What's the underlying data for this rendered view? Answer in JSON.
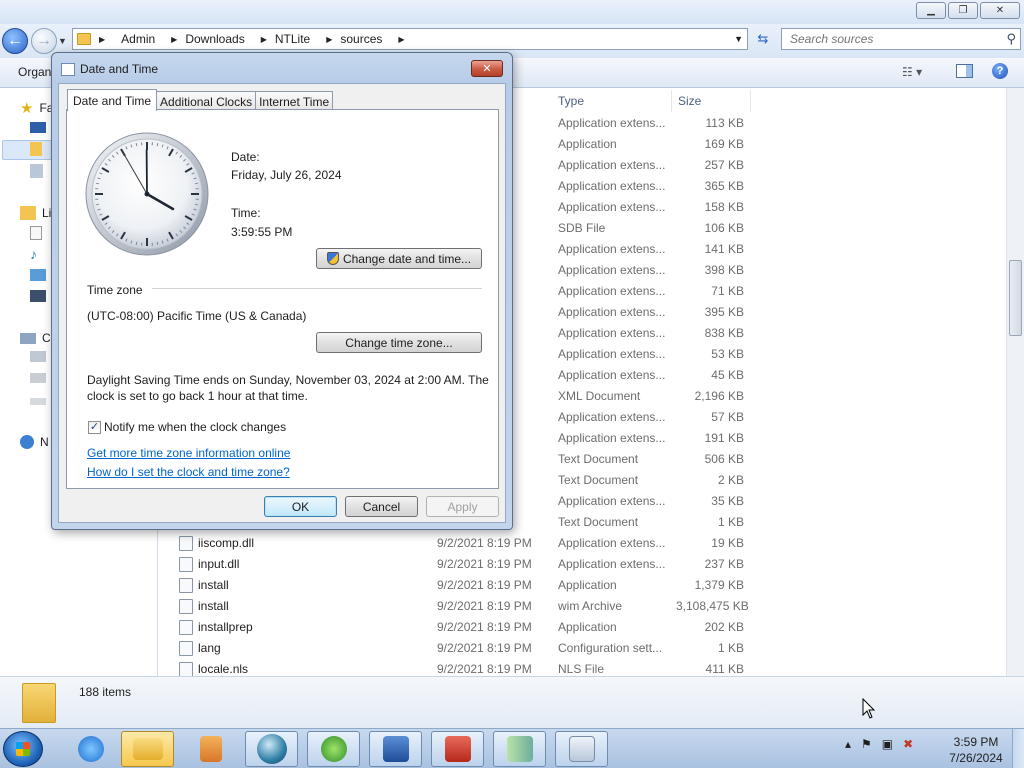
{
  "explorer": {
    "breadcrumb": [
      "Admin",
      "Downloads",
      "NTLite",
      "sources"
    ],
    "search_placeholder": "Search sources",
    "cmd_organize": "Organ",
    "columns": {
      "type": "Type",
      "size": "Size"
    },
    "nav_labels": [
      "Fa",
      "Li",
      "C",
      "N"
    ],
    "files": [
      {
        "name": "",
        "date": "PM",
        "type": "Application extens...",
        "size": "113 KB"
      },
      {
        "name": "",
        "date": "PM",
        "type": "Application",
        "size": "169 KB"
      },
      {
        "name": "",
        "date": "PM",
        "type": "Application extens...",
        "size": "257 KB"
      },
      {
        "name": "",
        "date": "PM",
        "type": "Application extens...",
        "size": "365 KB"
      },
      {
        "name": "",
        "date": "PM",
        "type": "Application extens...",
        "size": "158 KB"
      },
      {
        "name": "",
        "date": "PM",
        "type": "SDB File",
        "size": "106 KB"
      },
      {
        "name": "",
        "date": "PM",
        "type": "Application extens...",
        "size": "141 KB"
      },
      {
        "name": "",
        "date": "PM",
        "type": "Application extens...",
        "size": "398 KB"
      },
      {
        "name": "",
        "date": "PM",
        "type": "Application extens...",
        "size": "71 KB"
      },
      {
        "name": "",
        "date": "PM",
        "type": "Application extens...",
        "size": "395 KB"
      },
      {
        "name": "",
        "date": "PM",
        "type": "Application extens...",
        "size": "838 KB"
      },
      {
        "name": "",
        "date": "PM",
        "type": "Application extens...",
        "size": "53 KB"
      },
      {
        "name": "",
        "date": "PM",
        "type": "Application extens...",
        "size": "45 KB"
      },
      {
        "name": "",
        "date": "PM",
        "type": "XML Document",
        "size": "2,196 KB"
      },
      {
        "name": "",
        "date": "PM",
        "type": "Application extens...",
        "size": "57 KB"
      },
      {
        "name": "",
        "date": "PM",
        "type": "Application extens...",
        "size": "191 KB"
      },
      {
        "name": "",
        "date": "PM",
        "type": "Text Document",
        "size": "506 KB"
      },
      {
        "name": "",
        "date": "PM",
        "type": "Text Document",
        "size": "2 KB"
      },
      {
        "name": "",
        "date": "PM",
        "type": "Application extens...",
        "size": "35 KB"
      },
      {
        "name": "",
        "date": "PM",
        "type": "Text Document",
        "size": "1 KB"
      },
      {
        "name": "iiscomp.dll",
        "date": "9/2/2021 8:19 PM",
        "type": "Application extens...",
        "size": "19 KB"
      },
      {
        "name": "input.dll",
        "date": "9/2/2021 8:19 PM",
        "type": "Application extens...",
        "size": "237 KB"
      },
      {
        "name": "install",
        "date": "9/2/2021 8:19 PM",
        "type": "Application",
        "size": "1,379 KB"
      },
      {
        "name": "install",
        "date": "9/2/2021 8:19 PM",
        "type": "wim Archive",
        "size": "3,108,475 KB"
      },
      {
        "name": "installprep",
        "date": "9/2/2021 8:19 PM",
        "type": "Application",
        "size": "202 KB"
      },
      {
        "name": "lang",
        "date": "9/2/2021 8:19 PM",
        "type": "Configuration sett...",
        "size": "1 KB"
      },
      {
        "name": "locale.nls",
        "date": "9/2/2021 8:19 PM",
        "type": "NLS File",
        "size": "411 KB"
      }
    ],
    "item_count": "188 items"
  },
  "dialog": {
    "title": "Date and Time",
    "tabs": [
      "Date and Time",
      "Additional Clocks",
      "Internet Time"
    ],
    "date_label": "Date:",
    "date_value": "Friday, July 26, 2024",
    "time_label": "Time:",
    "time_value": "3:59:55 PM",
    "change_date_button": "Change date and time...",
    "timezone_heading": "Time zone",
    "timezone_value": "(UTC-08:00) Pacific Time (US & Canada)",
    "change_timezone_button": "Change time zone...",
    "dst_line1": "Daylight Saving Time ends on Sunday, November 03, 2024 at 2:00 AM. The",
    "dst_line2": "clock is set to go back 1 hour at that time.",
    "notify_label": "Notify me when the clock changes",
    "notify_checked": true,
    "link_tz_info": "Get more time zone information online",
    "link_howto": "How do I set the clock and time zone?",
    "ok": "OK",
    "cancel": "Cancel",
    "apply": "Apply",
    "clock_hands": {
      "hour": 3,
      "minute": 59,
      "second": 55
    }
  },
  "taskbar": {
    "time": "3:59 PM",
    "date": "7/26/2024",
    "buttons": [
      "internet-explorer-icon",
      "file-explorer-icon",
      "media-player-icon",
      "browser-globe-icon",
      "download-manager-icon",
      "ntlite-icon",
      "toolbox-icon",
      "sidebar-app-icon",
      "date-time-control-panel-icon"
    ]
  },
  "colors": {
    "link": "#0066cc",
    "titlebar": "#c6d8ef",
    "close_red": "#c85a42"
  }
}
